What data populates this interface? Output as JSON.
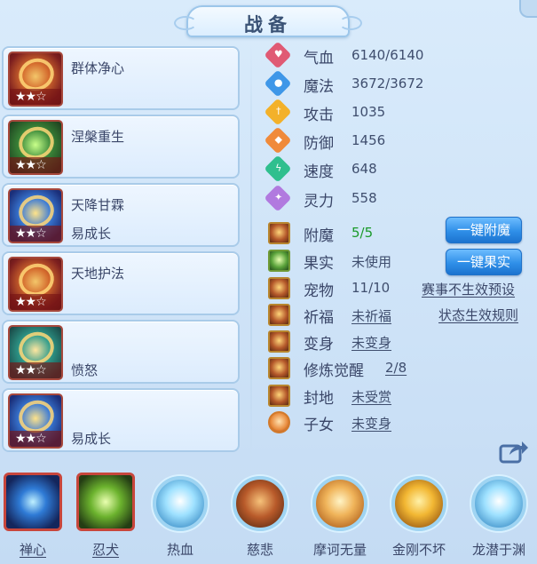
{
  "title": "战备",
  "skills": [
    {
      "name": "群体净心",
      "sub": "",
      "stars": "★★☆",
      "tone": "fire"
    },
    {
      "name": "涅槃重生",
      "sub": "",
      "stars": "★★☆",
      "tone": "green"
    },
    {
      "name": "天降甘霖",
      "sub": "易成长",
      "stars": "★★☆",
      "tone": "blue"
    },
    {
      "name": "天地护法",
      "sub": "",
      "stars": "★★☆",
      "tone": "fire"
    },
    {
      "name": "",
      "sub": "愤怒",
      "stars": "★★☆",
      "tone": "teal"
    },
    {
      "name": "",
      "sub": "易成长",
      "stars": "★★☆",
      "tone": "blue"
    }
  ],
  "attributes": [
    {
      "label": "气血",
      "value": "6140/6140",
      "icon": "heart-icon",
      "color": "#e05a74"
    },
    {
      "label": "魔法",
      "value": "3672/3672",
      "icon": "magic-icon",
      "color": "#3f97e8"
    },
    {
      "label": "攻击",
      "value": "1035",
      "icon": "sword-icon",
      "color": "#f3b12a"
    },
    {
      "label": "防御",
      "value": "1456",
      "icon": "shield-icon",
      "color": "#f08a3a"
    },
    {
      "label": "速度",
      "value": "648",
      "icon": "lightning-icon",
      "color": "#2fbf8e"
    },
    {
      "label": "灵力",
      "value": "558",
      "icon": "spirit-icon",
      "color": "#b17adf"
    }
  ],
  "equipment": {
    "enchant": {
      "label": "附魔",
      "value": "5/5",
      "button": "一键附魔"
    },
    "fruit": {
      "label": "果实",
      "value": "未使用",
      "button": "一键果实"
    },
    "pet": {
      "label": "宠物",
      "value": "11/10",
      "link": "赛事不生效预设"
    },
    "blessing": {
      "label": "祈福",
      "value": "未祈福",
      "link": "状态生效规则"
    },
    "transform": {
      "label": "变身",
      "value": "未变身"
    },
    "awaken": {
      "label": "修炼觉醒",
      "value": "2/8"
    },
    "territory": {
      "label": "封地",
      "value": "未受赏"
    },
    "children": {
      "label": "子女",
      "value": "未变身"
    }
  },
  "bottom_skills": [
    {
      "label": "禅心",
      "style": "box"
    },
    {
      "label": "忍犬",
      "style": "box-wolf"
    },
    {
      "label": "热血",
      "style": "orb-sky"
    },
    {
      "label": "慈悲",
      "style": "orb-brown"
    },
    {
      "label": "摩诃无量",
      "style": "orb"
    },
    {
      "label": "金刚不坏",
      "style": "orb-gold"
    },
    {
      "label": "龙潜于渊",
      "style": "orb-sky"
    }
  ]
}
